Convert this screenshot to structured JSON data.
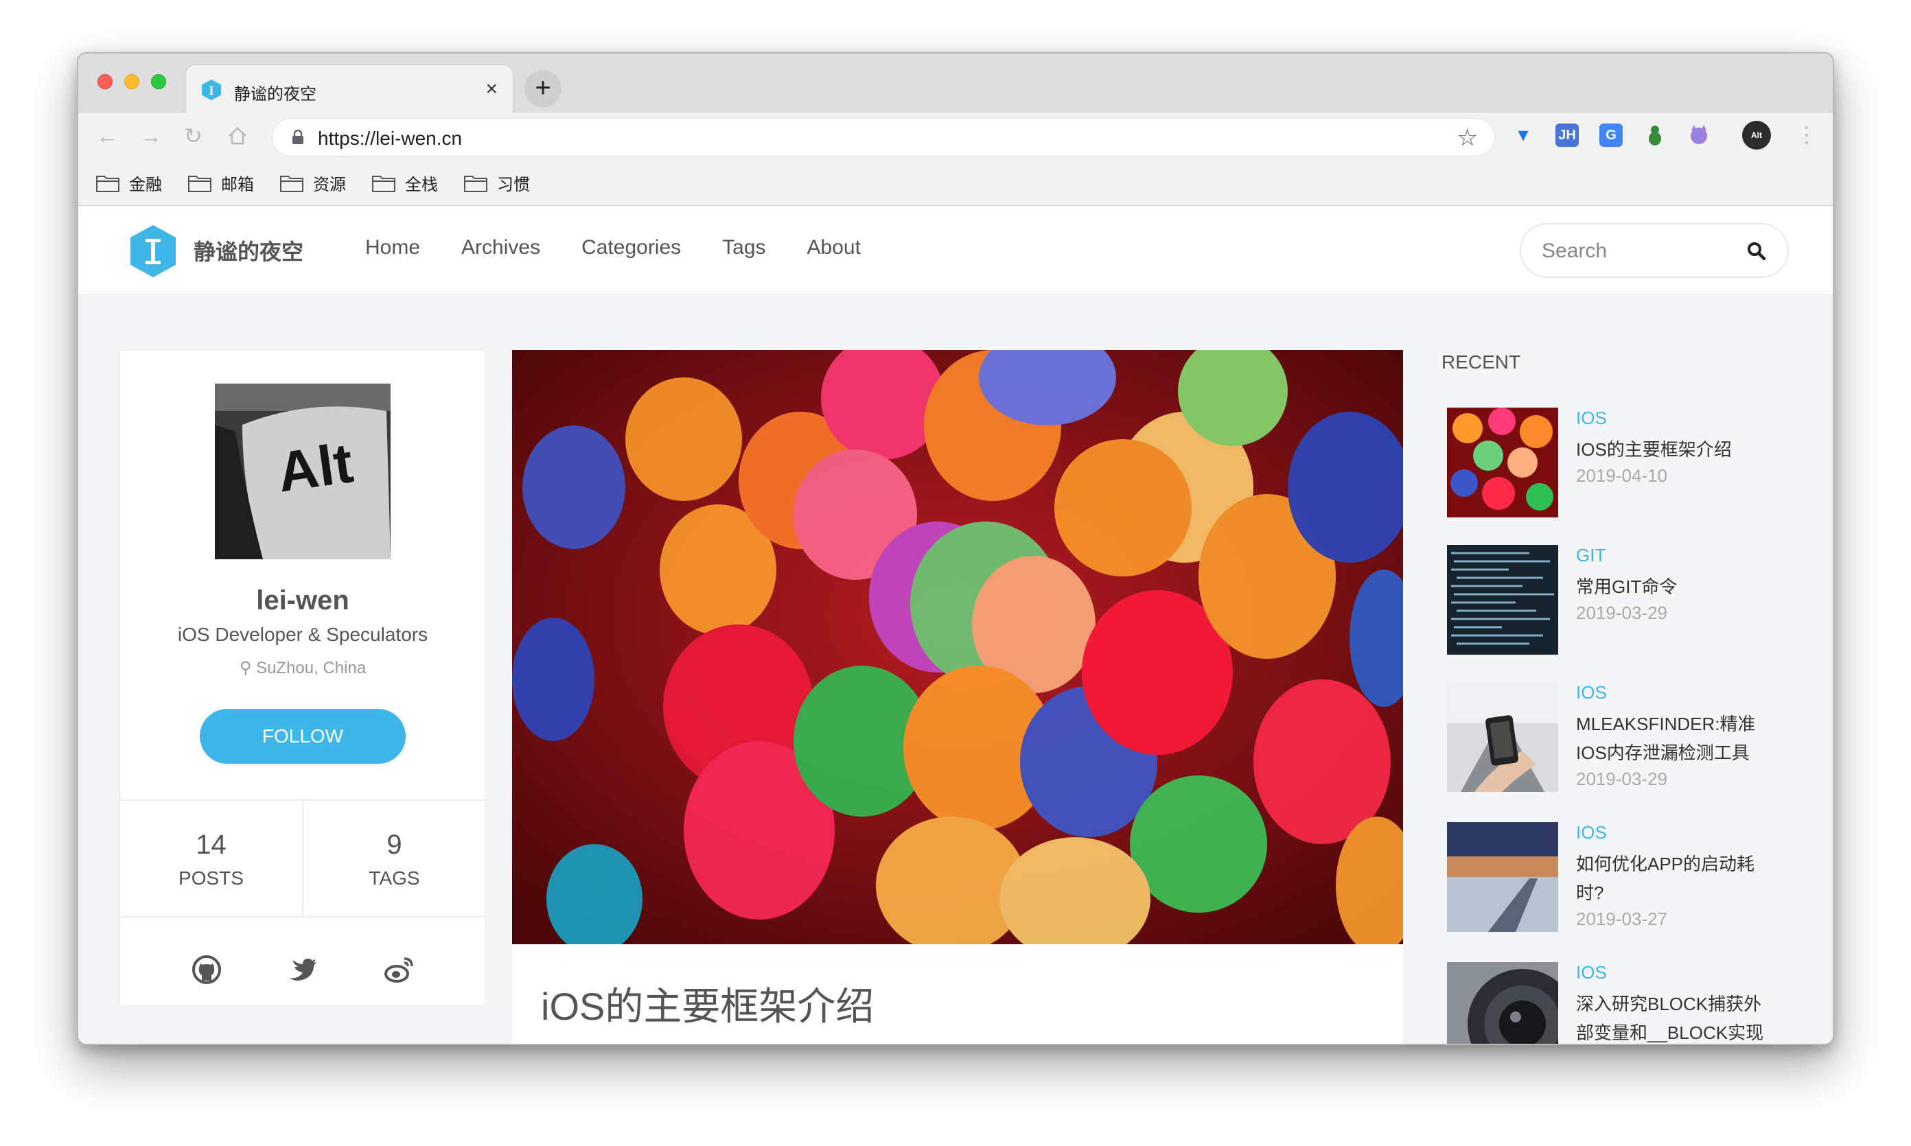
{
  "browser": {
    "tab_title": "静谧的夜空",
    "tab_close": "×",
    "new_tab": "+",
    "url": "https://lei-wen.cn",
    "bookmarks": [
      "金融",
      "邮箱",
      "资源",
      "全栈",
      "习惯"
    ],
    "extensions": [
      {
        "name": "vue-devtools-icon",
        "label": "",
        "color": "#1a73e8"
      },
      {
        "name": "jsonhandle-icon",
        "label": "JH",
        "color": "#4a74d8"
      },
      {
        "name": "translate-icon",
        "label": "G",
        "color": "#4285f4"
      },
      {
        "name": "android-icon",
        "label": "",
        "color": "#3a8a3a"
      },
      {
        "name": "octotree-icon",
        "label": "",
        "color": "#9b7fe0"
      }
    ]
  },
  "site": {
    "name": "静谧的夜空",
    "nav": [
      "Home",
      "Archives",
      "Categories",
      "Tags",
      "About"
    ],
    "search_placeholder": "Search",
    "accent": "#3fb6e8"
  },
  "profile": {
    "avatar_text": "Alt",
    "name": "lei-wen",
    "title": "iOS Developer & Speculators",
    "location": "SuZhou, China",
    "follow_label": "FOLLOW",
    "stats": [
      {
        "num": "14",
        "label": "POSTS"
      },
      {
        "num": "9",
        "label": "TAGS"
      }
    ],
    "social": [
      "github-icon",
      "twitter-icon",
      "weibo-icon"
    ]
  },
  "article": {
    "title": "iOS的主要框架介绍"
  },
  "recent": {
    "heading": "RECENT",
    "items": [
      {
        "category": "IOS",
        "title": "IOS的主要框架介绍",
        "date": "2019-04-10"
      },
      {
        "category": "GIT",
        "title": "常用GIT命令",
        "date": "2019-03-29"
      },
      {
        "category": "IOS",
        "title": "MLEAKSFINDER:精准IOS内存泄漏检测工具",
        "date": "2019-03-29"
      },
      {
        "category": "IOS",
        "title": "如何优化APP的启动耗时?",
        "date": "2019-03-27"
      },
      {
        "category": "IOS",
        "title": "深入研究BLOCK捕获外部变量和__BLOCK实现",
        "date": ""
      }
    ]
  }
}
